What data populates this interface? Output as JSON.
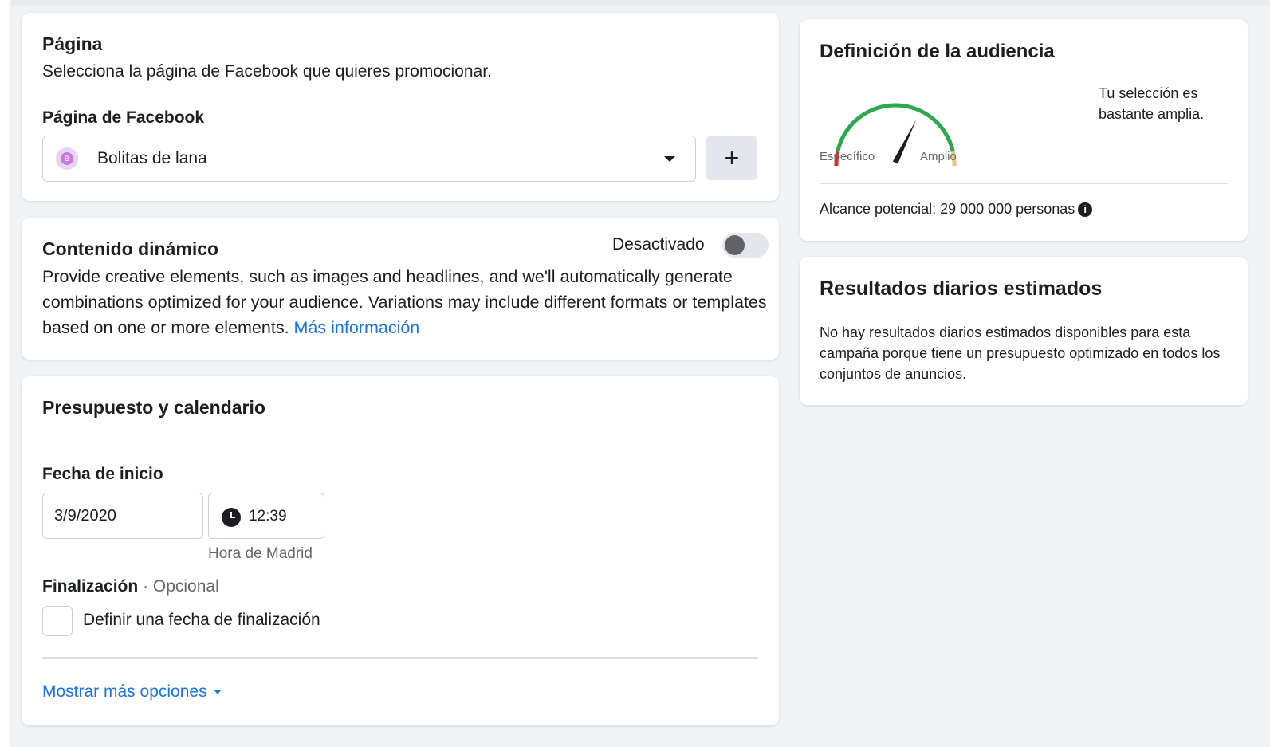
{
  "page_section": {
    "title": "Página",
    "description": "Selecciona la página de Facebook que quieres promocionar.",
    "field_label": "Página de Facebook",
    "selected_page": "Bolitas de lana",
    "avatar_letter": "B",
    "add_button": "+"
  },
  "dynamic_content": {
    "title": "Contenido dinámico",
    "toggle_status": "Desactivado",
    "toggle_on": false,
    "description": "Provide creative elements, such as images and headlines, and we'll automatically generate combinations optimized for your audience. Variations may include different formats or templates based on one or more elements.",
    "more_info_link": "Más información"
  },
  "budget": {
    "title": "Presupuesto y calendario",
    "start_date_label": "Fecha de inicio",
    "start_date": "3/9/2020",
    "start_time": "12:39",
    "timezone": "Hora de Madrid",
    "end_label": "Finalización",
    "end_optional": "· Opcional",
    "end_checkbox_label": "Definir una fecha de finalización",
    "end_checked": false,
    "more_options_link": "Mostrar más opciones"
  },
  "audience": {
    "title": "Definición de la audiencia",
    "gauge_left_label": "Específico",
    "gauge_right_label": "Amplio",
    "gauge_level": 0.62,
    "selection_status": "Tu selección es bastante amplia.",
    "potential_reach": "Alcance potencial: 29 000 000 personas",
    "colors": {
      "specific": "#e02c2c",
      "good": "#2ea84f",
      "broad": "#f2c27a"
    }
  },
  "results": {
    "title": "Resultados diarios estimados",
    "description": "No hay resultados diarios estimados disponibles para esta campaña porque tiene un presupuesto optimizado en todos los conjuntos de anuncios."
  },
  "colors": {
    "link": "#1a73e8",
    "background": "#f0f2f5"
  }
}
